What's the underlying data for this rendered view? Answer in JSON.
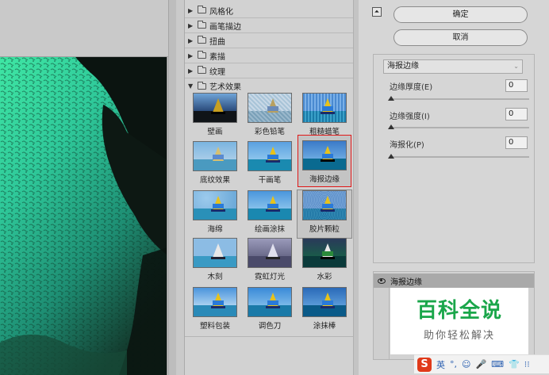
{
  "categories": [
    {
      "label": "风格化",
      "expanded": false
    },
    {
      "label": "画笔描边",
      "expanded": false
    },
    {
      "label": "扭曲",
      "expanded": false
    },
    {
      "label": "素描",
      "expanded": false
    },
    {
      "label": "纹理",
      "expanded": false
    },
    {
      "label": "艺术效果",
      "expanded": true
    }
  ],
  "filters": [
    {
      "label": "壁画"
    },
    {
      "label": "彩色铅笔"
    },
    {
      "label": "粗糙蜡笔"
    },
    {
      "label": "底纹效果"
    },
    {
      "label": "干画笔"
    },
    {
      "label": "海报边缘"
    },
    {
      "label": "海绵"
    },
    {
      "label": "绘画涂抹"
    },
    {
      "label": "胶片颗粒"
    },
    {
      "label": "木刻"
    },
    {
      "label": "霓虹灯光"
    },
    {
      "label": "水彩"
    },
    {
      "label": "塑料包装"
    },
    {
      "label": "调色刀"
    },
    {
      "label": "涂抹棒"
    }
  ],
  "selected_filter": "海报边缘",
  "buttons": {
    "ok": "确定",
    "cancel": "取消"
  },
  "settings": {
    "filter_select": "海报边缘",
    "params": [
      {
        "label": "边缘厚度(E)",
        "value": "0"
      },
      {
        "label": "边缘强度(I)",
        "value": "0"
      },
      {
        "label": "海报化(P)",
        "value": "0"
      }
    ]
  },
  "layer": {
    "name": "海报边缘"
  },
  "watermark": {
    "title": "百科全说",
    "subtitle": "助你轻松解决"
  },
  "ime": {
    "logo": "S",
    "items": [
      "英",
      "°,",
      "☺",
      "🎤",
      "⌨",
      "👕",
      "⁝⁝"
    ]
  }
}
